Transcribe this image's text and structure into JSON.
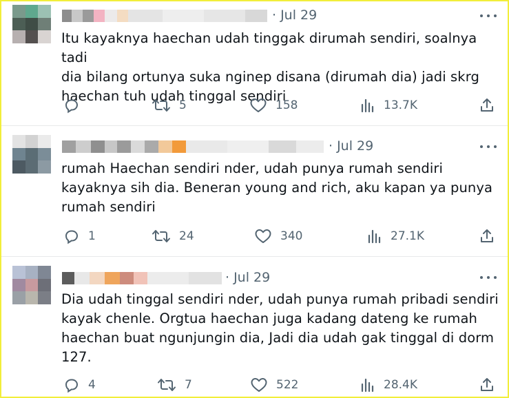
{
  "tweets": [
    {
      "time": "· Jul 29",
      "text": "Itu kayaknya haechan udah tinggak dirumah sendiri, soalnya tadi\ndia bilang ortunya suka nginep disana (dirumah dia) jadi skrg\nhaechan tuh udah tinggal sendiri",
      "replies": "",
      "retweets": "5",
      "likes": "158",
      "views": "13.7K"
    },
    {
      "time": "· Jul 29",
      "text": "rumah Haechan sendiri nder, udah punya rumah sendiri\nkayaknya sih dia. Beneran young and rich, aku kapan ya punya\nrumah sendiri",
      "replies": "1",
      "retweets": "24",
      "likes": "340",
      "views": "27.1K"
    },
    {
      "time": "· Jul 29",
      "text": "Dia udah tinggal sendiri nder, udah punya rumah pribadi sendiri\nkayak chenle. Orgtua haechan juga kadang dateng ke rumah\nhaechan buat ngunjungin dia, Jadi dia udah gak tinggal di dorm\n127.",
      "replies": "4",
      "retweets": "7",
      "likes": "522",
      "views": "28.4K"
    }
  ],
  "colors": {
    "text": "#0f1419",
    "muted": "#536471",
    "divider": "#e7e9ea",
    "frame": "#f2ee3a"
  },
  "icons": [
    "reply-icon",
    "retweet-icon",
    "like-icon",
    "views-icon",
    "share-icon",
    "more-icon"
  ]
}
